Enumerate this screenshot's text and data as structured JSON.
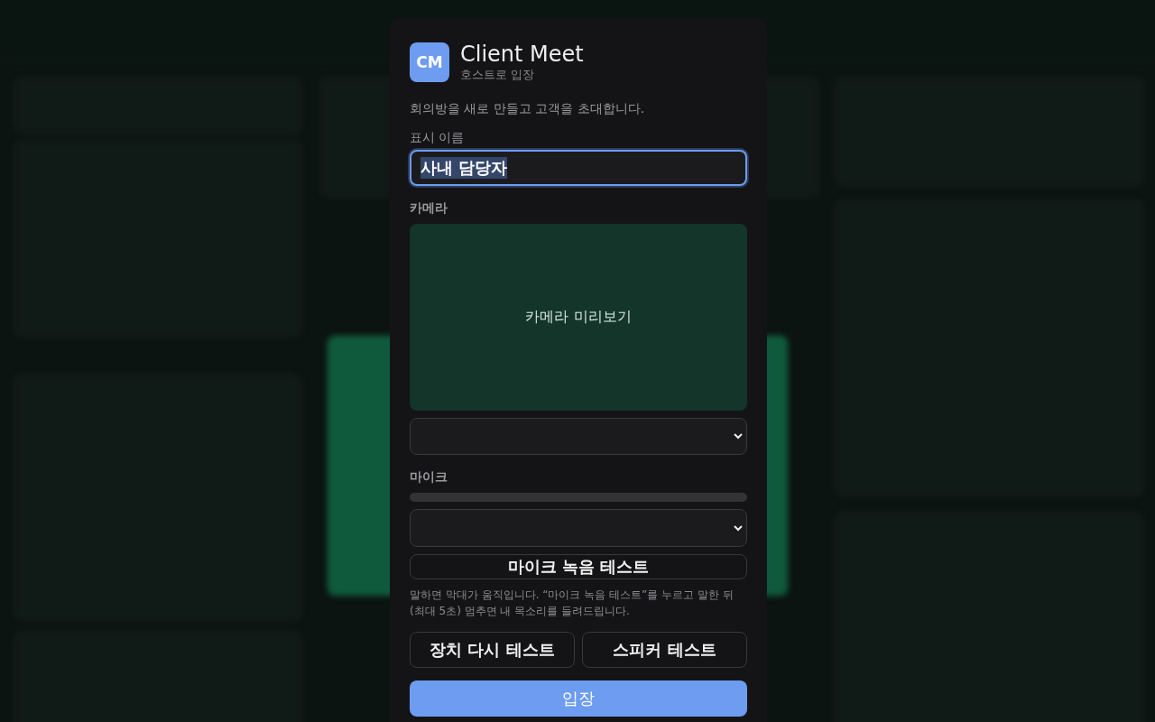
{
  "dialog": {
    "logo": "CM",
    "title": "Client Meet",
    "subtitle": "호스트로 입장",
    "description": "회의방을 새로 만들고 고객을 초대합니다.",
    "name_field": {
      "label": "표시 이름",
      "value": "사내 담당자"
    },
    "camera": {
      "label": "카메라",
      "preview": "카메라 미리보기"
    },
    "mic": {
      "label": "마이크",
      "level": 0
    },
    "mic_test_button": "마이크 녹음 테스트",
    "help": "말하면 막대가 움직입니다. “마이크 녹음 테스트”를 누르고 말한 뒤 (최대 5초) 멈추면 내 목소리를 들려드립니다.",
    "buttons": [
      "장치 다시 테스트",
      "스피커 테스트"
    ],
    "enter_button": "입장"
  }
}
